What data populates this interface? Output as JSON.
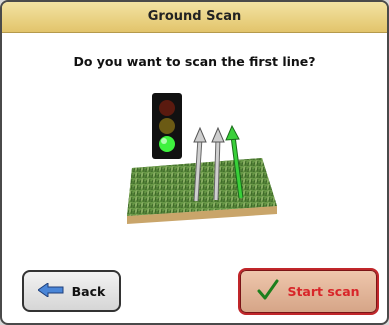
{
  "dialog": {
    "title": "Ground Scan",
    "question": "Do you want to scan the first line?"
  },
  "buttons": {
    "back_label": "Back",
    "start_label": "Start scan"
  },
  "illustration": {
    "traffic_light_state": "green",
    "arrows": [
      "gray",
      "gray",
      "green"
    ],
    "icon_names": [
      "traffic-light-icon",
      "scan-lines-icon",
      "grass-patch-icon"
    ]
  },
  "colors": {
    "title_bar": "#e2c46b",
    "start_border": "#c0262a",
    "start_text": "#d8262a",
    "active_arrow": "#33cc33"
  }
}
